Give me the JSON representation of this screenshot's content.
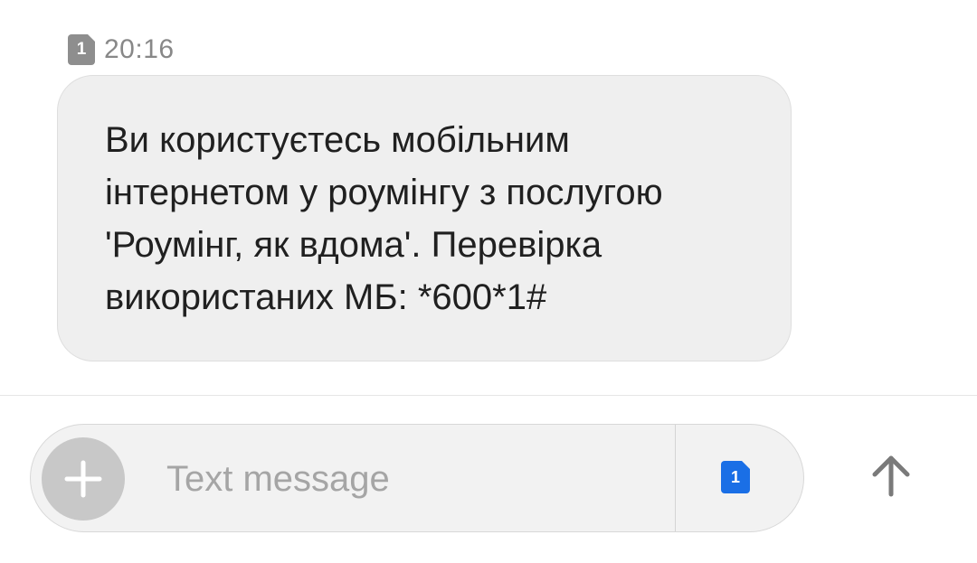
{
  "message": {
    "sim_number": "1",
    "time": "20:16",
    "text": "Ви користуєтесь мобільним\nінтернетом у роумінгу з послугою\n'Роумінг, як вдома'. Перевірка\nвикористаних МБ: *600*1#"
  },
  "composer": {
    "placeholder": "Text message",
    "value": "",
    "sim_number": "1",
    "add_icon": "plus-icon",
    "send_icon": "arrow-up-icon"
  },
  "colors": {
    "bubble_bg": "#efefef",
    "sim_badge_gray": "#8e8e8e",
    "sim_badge_blue": "#1a6fe6",
    "add_button_bg": "#c8c8c8",
    "send_arrow": "#7a7a7a"
  }
}
